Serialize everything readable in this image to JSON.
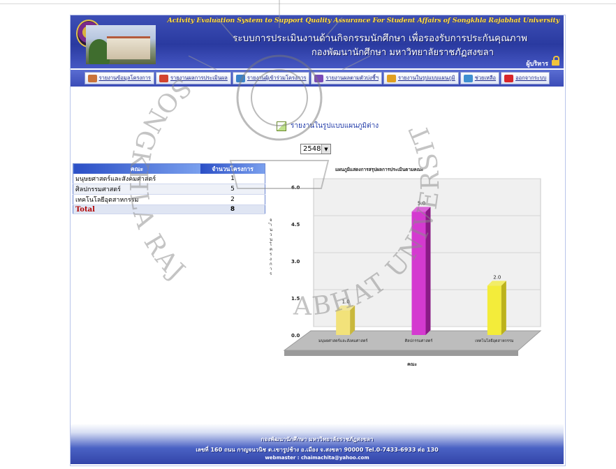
{
  "header": {
    "title_en": "Activity Evaluation System to Support Quality Assurance For Student Affairs of Songkhla Rajabhat University",
    "title_th": "ระบบการประเมินงานด้านกิจกรรมนักศึกษา  เพื่อรองรับการประกันคุณภาพ",
    "subtitle_th": "กองพัฒนานักศึกษา  มหาวิทยาลัยราชภัฏสงขลา",
    "admin_label": "ผู้บริหาร"
  },
  "nav": {
    "items": [
      {
        "label": "รายงานข้อมูลโครงการ",
        "icon": "report-icon",
        "color": "#c9733a"
      },
      {
        "label": "รายงานผลการประเมินผล",
        "icon": "pie-chart-icon",
        "color": "#d2442f"
      },
      {
        "label": "รายงานผู้เข้าร่วมโครงการ",
        "icon": "people-icon",
        "color": "#3a82c9"
      },
      {
        "label": "รายงานผลตามตัวบ่งชี้ฯ",
        "icon": "chart-icon",
        "color": "#7a4ab8"
      },
      {
        "label": "รายงานในรูปแบบแผนภูมิ",
        "icon": "globe-icon",
        "color": "#e0a020"
      },
      {
        "label": "ช่วยเหลือ",
        "icon": "help-icon",
        "color": "#3f8fd0"
      },
      {
        "label": "ออกจากระบบ",
        "icon": "logout-icon",
        "color": "#d8262a"
      }
    ]
  },
  "page": {
    "title": "รายงานในรูปแบบแผนภูมิต่าง",
    "year_selected": "2548"
  },
  "table": {
    "headers": [
      "คณะ",
      "จำนวนโครงการ"
    ],
    "rows": [
      {
        "faculty": "มนุษยศาสตร์และสังคมศาสตร์",
        "count": "1"
      },
      {
        "faculty": "ศิลปกรรมศาสตร์",
        "count": "5"
      },
      {
        "faculty": "เทคโนโลยีอุตสาหกรรม",
        "count": "2"
      }
    ],
    "total_label": "Total",
    "total_value": "8"
  },
  "chart_data": {
    "type": "bar",
    "title": "แผนภูมิแสดงการสรุปผลการประเมินตามคณะ",
    "xlabel": "คณะ",
    "ylabel": "จำนวนโครงการ",
    "categories": [
      "มนุษยศาสตร์และสังคมศาสตร์",
      "ศิลปกรรมศาสตร์",
      "เทคโนโลยีอุตสาหกรรม"
    ],
    "values": [
      1,
      5,
      2
    ],
    "value_labels": [
      "1.0",
      "5.0",
      "2.0"
    ],
    "yticks": [
      "0.0",
      "1.5",
      "3.0",
      "4.5",
      "6.0"
    ],
    "ylim": [
      0,
      6
    ],
    "bar_colors": [
      "#f2e27a",
      "#d43ad0",
      "#f3ec3a"
    ],
    "grid": true
  },
  "footer": {
    "line1": "กองพัฒนานักศึกษา มหาวิทยาลัยราชภัฏสงขลา",
    "line2": "เลขที่ 160 ถนน กาญจนวนิช ต.เขารูปช้าง อ.เมือง จ.สงขลา 90000 Tel.0-7433-6933 ต่อ 130",
    "line3": "webmaster : chaimachita@yahoo.com"
  },
  "watermark": {
    "text_left": "SONGKHLA RAJABHAT UNIVERSITY"
  }
}
